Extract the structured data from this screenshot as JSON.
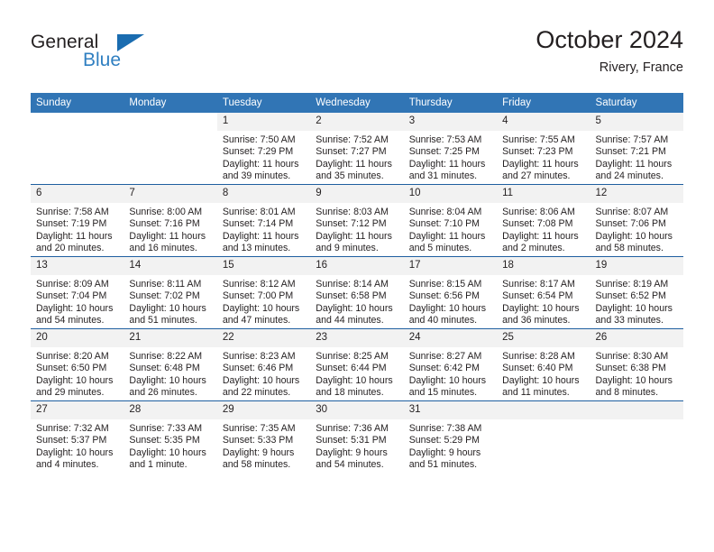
{
  "logo": {
    "word_one": "General",
    "word_two": "Blue",
    "triangle_icon": "triangle-icon"
  },
  "header": {
    "title": "October 2024",
    "subtitle": "Rivery, France"
  },
  "colors": {
    "header_blue": "#3175b5",
    "week_separator_blue": "#1f5fa0",
    "daynum_band": "#f2f2f2",
    "logo_blue": "#2f7fc1",
    "text": "#231f20"
  },
  "labels": {
    "sunrise_prefix": "Sunrise:",
    "sunset_prefix": "Sunset:",
    "daylight_prefix": "Daylight:"
  },
  "weekdays": [
    "Sunday",
    "Monday",
    "Tuesday",
    "Wednesday",
    "Thursday",
    "Friday",
    "Saturday"
  ],
  "weeks": [
    [
      {
        "day": "",
        "blank": true,
        "sunrise": "",
        "sunset": "",
        "daylight_line1": "",
        "daylight_line2": ""
      },
      {
        "day": "",
        "blank": true,
        "sunrise": "",
        "sunset": "",
        "daylight_line1": "",
        "daylight_line2": ""
      },
      {
        "day": "1",
        "sunrise": "Sunrise: 7:50 AM",
        "sunset": "Sunset: 7:29 PM",
        "daylight_line1": "Daylight: 11 hours",
        "daylight_line2": "and 39 minutes."
      },
      {
        "day": "2",
        "sunrise": "Sunrise: 7:52 AM",
        "sunset": "Sunset: 7:27 PM",
        "daylight_line1": "Daylight: 11 hours",
        "daylight_line2": "and 35 minutes."
      },
      {
        "day": "3",
        "sunrise": "Sunrise: 7:53 AM",
        "sunset": "Sunset: 7:25 PM",
        "daylight_line1": "Daylight: 11 hours",
        "daylight_line2": "and 31 minutes."
      },
      {
        "day": "4",
        "sunrise": "Sunrise: 7:55 AM",
        "sunset": "Sunset: 7:23 PM",
        "daylight_line1": "Daylight: 11 hours",
        "daylight_line2": "and 27 minutes."
      },
      {
        "day": "5",
        "sunrise": "Sunrise: 7:57 AM",
        "sunset": "Sunset: 7:21 PM",
        "daylight_line1": "Daylight: 11 hours",
        "daylight_line2": "and 24 minutes."
      }
    ],
    [
      {
        "day": "6",
        "sunrise": "Sunrise: 7:58 AM",
        "sunset": "Sunset: 7:19 PM",
        "daylight_line1": "Daylight: 11 hours",
        "daylight_line2": "and 20 minutes."
      },
      {
        "day": "7",
        "sunrise": "Sunrise: 8:00 AM",
        "sunset": "Sunset: 7:16 PM",
        "daylight_line1": "Daylight: 11 hours",
        "daylight_line2": "and 16 minutes."
      },
      {
        "day": "8",
        "sunrise": "Sunrise: 8:01 AM",
        "sunset": "Sunset: 7:14 PM",
        "daylight_line1": "Daylight: 11 hours",
        "daylight_line2": "and 13 minutes."
      },
      {
        "day": "9",
        "sunrise": "Sunrise: 8:03 AM",
        "sunset": "Sunset: 7:12 PM",
        "daylight_line1": "Daylight: 11 hours",
        "daylight_line2": "and 9 minutes."
      },
      {
        "day": "10",
        "sunrise": "Sunrise: 8:04 AM",
        "sunset": "Sunset: 7:10 PM",
        "daylight_line1": "Daylight: 11 hours",
        "daylight_line2": "and 5 minutes."
      },
      {
        "day": "11",
        "sunrise": "Sunrise: 8:06 AM",
        "sunset": "Sunset: 7:08 PM",
        "daylight_line1": "Daylight: 11 hours",
        "daylight_line2": "and 2 minutes."
      },
      {
        "day": "12",
        "sunrise": "Sunrise: 8:07 AM",
        "sunset": "Sunset: 7:06 PM",
        "daylight_line1": "Daylight: 10 hours",
        "daylight_line2": "and 58 minutes."
      }
    ],
    [
      {
        "day": "13",
        "sunrise": "Sunrise: 8:09 AM",
        "sunset": "Sunset: 7:04 PM",
        "daylight_line1": "Daylight: 10 hours",
        "daylight_line2": "and 54 minutes."
      },
      {
        "day": "14",
        "sunrise": "Sunrise: 8:11 AM",
        "sunset": "Sunset: 7:02 PM",
        "daylight_line1": "Daylight: 10 hours",
        "daylight_line2": "and 51 minutes."
      },
      {
        "day": "15",
        "sunrise": "Sunrise: 8:12 AM",
        "sunset": "Sunset: 7:00 PM",
        "daylight_line1": "Daylight: 10 hours",
        "daylight_line2": "and 47 minutes."
      },
      {
        "day": "16",
        "sunrise": "Sunrise: 8:14 AM",
        "sunset": "Sunset: 6:58 PM",
        "daylight_line1": "Daylight: 10 hours",
        "daylight_line2": "and 44 minutes."
      },
      {
        "day": "17",
        "sunrise": "Sunrise: 8:15 AM",
        "sunset": "Sunset: 6:56 PM",
        "daylight_line1": "Daylight: 10 hours",
        "daylight_line2": "and 40 minutes."
      },
      {
        "day": "18",
        "sunrise": "Sunrise: 8:17 AM",
        "sunset": "Sunset: 6:54 PM",
        "daylight_line1": "Daylight: 10 hours",
        "daylight_line2": "and 36 minutes."
      },
      {
        "day": "19",
        "sunrise": "Sunrise: 8:19 AM",
        "sunset": "Sunset: 6:52 PM",
        "daylight_line1": "Daylight: 10 hours",
        "daylight_line2": "and 33 minutes."
      }
    ],
    [
      {
        "day": "20",
        "sunrise": "Sunrise: 8:20 AM",
        "sunset": "Sunset: 6:50 PM",
        "daylight_line1": "Daylight: 10 hours",
        "daylight_line2": "and 29 minutes."
      },
      {
        "day": "21",
        "sunrise": "Sunrise: 8:22 AM",
        "sunset": "Sunset: 6:48 PM",
        "daylight_line1": "Daylight: 10 hours",
        "daylight_line2": "and 26 minutes."
      },
      {
        "day": "22",
        "sunrise": "Sunrise: 8:23 AM",
        "sunset": "Sunset: 6:46 PM",
        "daylight_line1": "Daylight: 10 hours",
        "daylight_line2": "and 22 minutes."
      },
      {
        "day": "23",
        "sunrise": "Sunrise: 8:25 AM",
        "sunset": "Sunset: 6:44 PM",
        "daylight_line1": "Daylight: 10 hours",
        "daylight_line2": "and 18 minutes."
      },
      {
        "day": "24",
        "sunrise": "Sunrise: 8:27 AM",
        "sunset": "Sunset: 6:42 PM",
        "daylight_line1": "Daylight: 10 hours",
        "daylight_line2": "and 15 minutes."
      },
      {
        "day": "25",
        "sunrise": "Sunrise: 8:28 AM",
        "sunset": "Sunset: 6:40 PM",
        "daylight_line1": "Daylight: 10 hours",
        "daylight_line2": "and 11 minutes."
      },
      {
        "day": "26",
        "sunrise": "Sunrise: 8:30 AM",
        "sunset": "Sunset: 6:38 PM",
        "daylight_line1": "Daylight: 10 hours",
        "daylight_line2": "and 8 minutes."
      }
    ],
    [
      {
        "day": "27",
        "sunrise": "Sunrise: 7:32 AM",
        "sunset": "Sunset: 5:37 PM",
        "daylight_line1": "Daylight: 10 hours",
        "daylight_line2": "and 4 minutes."
      },
      {
        "day": "28",
        "sunrise": "Sunrise: 7:33 AM",
        "sunset": "Sunset: 5:35 PM",
        "daylight_line1": "Daylight: 10 hours",
        "daylight_line2": "and 1 minute."
      },
      {
        "day": "29",
        "sunrise": "Sunrise: 7:35 AM",
        "sunset": "Sunset: 5:33 PM",
        "daylight_line1": "Daylight: 9 hours",
        "daylight_line2": "and 58 minutes."
      },
      {
        "day": "30",
        "sunrise": "Sunrise: 7:36 AM",
        "sunset": "Sunset: 5:31 PM",
        "daylight_line1": "Daylight: 9 hours",
        "daylight_line2": "and 54 minutes."
      },
      {
        "day": "31",
        "sunrise": "Sunrise: 7:38 AM",
        "sunset": "Sunset: 5:29 PM",
        "daylight_line1": "Daylight: 9 hours",
        "daylight_line2": "and 51 minutes."
      },
      {
        "day": "",
        "empty": true,
        "sunrise": "",
        "sunset": "",
        "daylight_line1": "",
        "daylight_line2": ""
      },
      {
        "day": "",
        "empty": true,
        "sunrise": "",
        "sunset": "",
        "daylight_line1": "",
        "daylight_line2": ""
      }
    ]
  ]
}
